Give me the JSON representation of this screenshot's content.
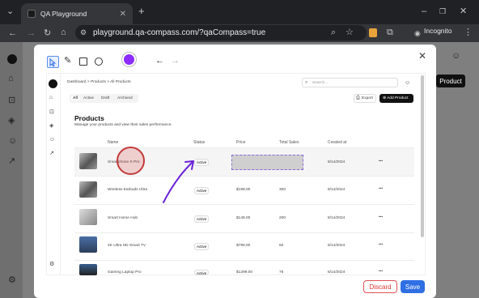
{
  "browser": {
    "tab_title": "QA Playground",
    "url": "playground.qa-compass.com/?qaCompass=true",
    "incognito_label": "Incognito"
  },
  "background": {
    "button_label": "Product"
  },
  "dashboard": {
    "breadcrumb": [
      "Dashboard",
      "Products",
      "All Products"
    ],
    "search_placeholder": "Search...",
    "filters": [
      "All",
      "Active",
      "Draft",
      "Archived"
    ],
    "export_label": "Export",
    "add_product_label": "Add Product",
    "title": "Products",
    "subtitle": "Manage your products and view their sales performance.",
    "columns": [
      "Name",
      "Status",
      "Price",
      "Total Sales",
      "Created at"
    ],
    "rows": [
      {
        "name": "Smartphone X Pro",
        "status": "Active",
        "price": "",
        "sales": "",
        "created": "8/14/2024"
      },
      {
        "name": "Wireless Earbuds Ultra",
        "status": "Active",
        "price": "$199.00",
        "sales": "300",
        "created": "8/14/2024"
      },
      {
        "name": "Smart Home Hub",
        "status": "Active",
        "price": "$149.00",
        "sales": "200",
        "created": "8/14/2024"
      },
      {
        "name": "4K Ultra HD Smart TV",
        "status": "Active",
        "price": "$799.00",
        "sales": "50",
        "created": "8/14/2024"
      },
      {
        "name": "Gaming Laptop Pro",
        "status": "Active",
        "price": "$1299.00",
        "sales": "75",
        "created": "8/14/2024"
      }
    ],
    "row_menu": "•••"
  },
  "annotation_tools": {
    "active_color": "#8e2cff"
  },
  "footer": {
    "discard_label": "Discard",
    "save_label": "Save"
  }
}
